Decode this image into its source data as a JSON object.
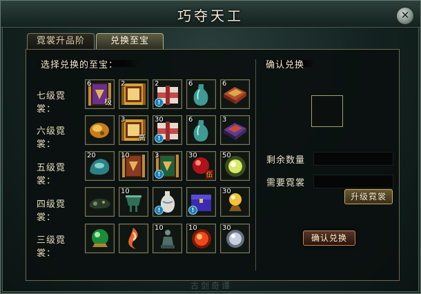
{
  "window": {
    "title": "巧夺天工",
    "close_glyph": "✕"
  },
  "tabs": [
    {
      "label": "霓裳升品阶",
      "active": false
    },
    {
      "label": "兑换至宝",
      "active": true
    }
  ],
  "left_panel": {
    "title": "选择兑换的至宝：",
    "rows": [
      {
        "label": "七级霓裳：",
        "items": [
          {
            "name": "scroll-icon",
            "count": "6",
            "tag": "极"
          },
          {
            "name": "golden-scroll-icon",
            "count": "2",
            "tag": ""
          },
          {
            "name": "silk-bundle-icon",
            "count": "2",
            "tag": "",
            "info": true
          },
          {
            "name": "jade-vase-icon",
            "count": "6",
            "tag": ""
          },
          {
            "name": "brocade-box-icon",
            "count": "6",
            "tag": ""
          }
        ]
      },
      {
        "label": "六级霓裳：",
        "items": [
          {
            "name": "amber-stone-icon",
            "count": "",
            "tag": ""
          },
          {
            "name": "golden-scroll-icon",
            "count": "3",
            "tag": "高"
          },
          {
            "name": "silk-bundle-icon",
            "count": "30",
            "tag": "",
            "info": true
          },
          {
            "name": "jade-vase-icon",
            "count": "6",
            "tag": ""
          },
          {
            "name": "brocade-box-icon",
            "count": "3",
            "tag": ""
          }
        ]
      },
      {
        "label": "五级霓裳：",
        "items": [
          {
            "name": "jade-stone-icon",
            "count": "20",
            "tag": ""
          },
          {
            "name": "scroll-icon",
            "count": "10",
            "tag": ""
          },
          {
            "name": "scroll-icon",
            "count": "3",
            "tag": "",
            "info": true
          },
          {
            "name": "red-orb-icon",
            "count": "30",
            "tag": "伍"
          },
          {
            "name": "glowing-orb-icon",
            "count": "50",
            "tag": ""
          }
        ]
      },
      {
        "label": "四级霓裳：",
        "items": [
          {
            "name": "dark-ore-icon",
            "count": "",
            "tag": ""
          },
          {
            "name": "bronze-vessel-icon",
            "count": "10",
            "tag": ""
          },
          {
            "name": "porcelain-vase-icon",
            "count": "",
            "tag": "",
            "info": true
          },
          {
            "name": "purple-chest-icon",
            "count": "",
            "tag": "",
            "info": true
          },
          {
            "name": "pearl-stand-icon",
            "count": "30",
            "tag": ""
          }
        ]
      },
      {
        "label": "三级霓裳：",
        "items": [
          {
            "name": "green-orb-icon",
            "count": "",
            "tag": ""
          },
          {
            "name": "flame-swirl-icon",
            "count": "",
            "tag": ""
          },
          {
            "name": "statue-icon",
            "count": "10",
            "tag": ""
          },
          {
            "name": "fire-orb-icon",
            "count": "10",
            "tag": ""
          },
          {
            "name": "silver-orb-icon",
            "count": "30",
            "tag": ""
          }
        ]
      }
    ]
  },
  "right_panel": {
    "title": "确认兑换",
    "remaining_label": "剩余数量",
    "remaining_value": "",
    "required_label": "需要霓裳",
    "required_value": "",
    "upgrade_button": "升级霓裳",
    "confirm_button": "确认兑换"
  },
  "footer": {
    "text": "古剑奇谭"
  },
  "colors": {
    "gold": "#c7ad6b",
    "panel_border": "#6e6a52",
    "bg": "#0d1816"
  }
}
